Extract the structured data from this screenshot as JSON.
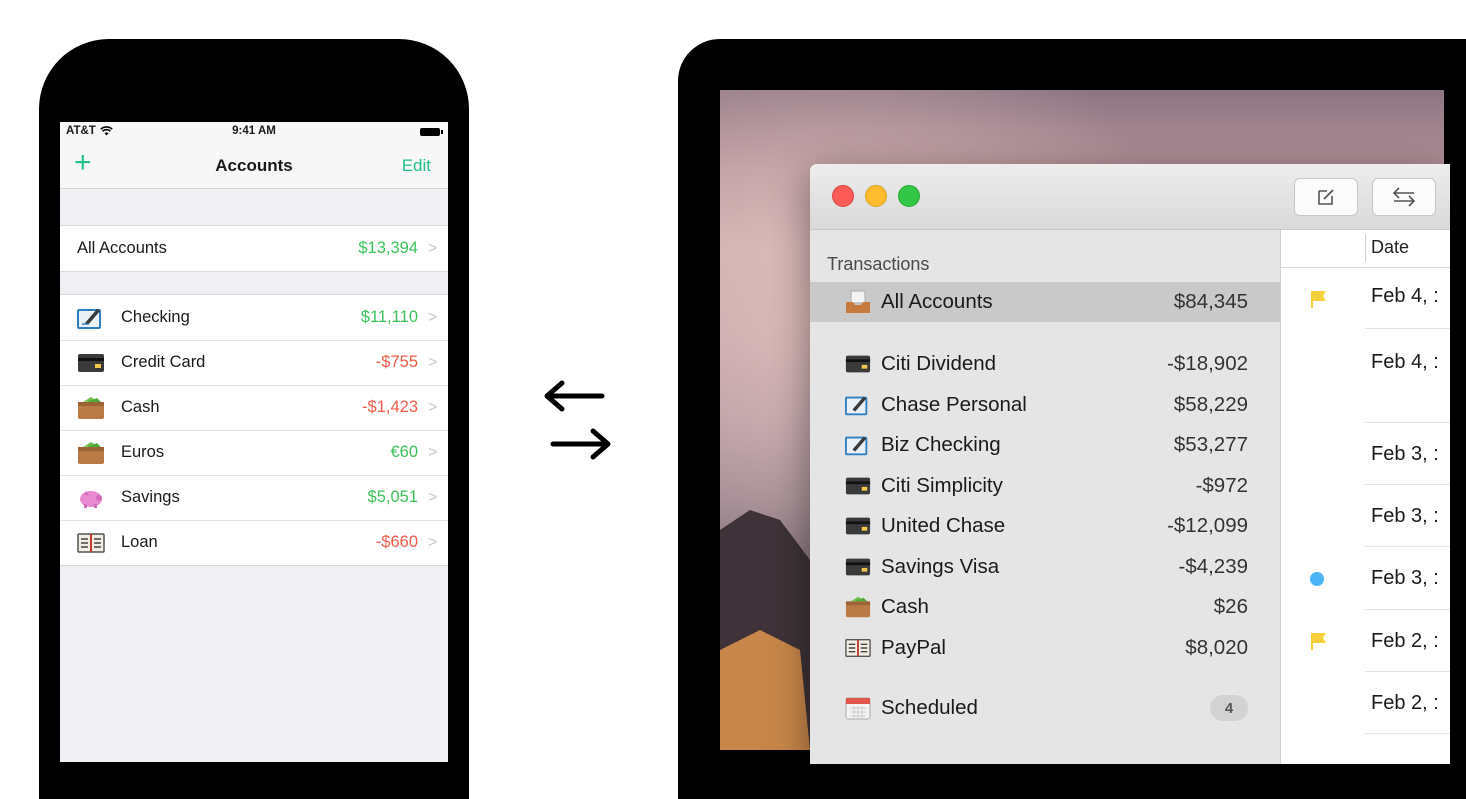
{
  "phone": {
    "status": {
      "carrier": "AT&T",
      "time": "9:41 AM"
    },
    "nav": {
      "title": "Accounts",
      "edit_label": "Edit",
      "add_label": "+"
    },
    "all_accounts": {
      "label": "All Accounts",
      "amount": "$13,394"
    },
    "accounts": [
      {
        "label": "Checking",
        "amount": "$11,110",
        "icon": "checkbook-icon"
      },
      {
        "label": "Credit Card",
        "amount": "-$755",
        "icon": "credit-card-icon"
      },
      {
        "label": "Cash",
        "amount": "-$1,423",
        "icon": "wallet-icon"
      },
      {
        "label": "Euros",
        "amount": "€60",
        "icon": "wallet-icon"
      },
      {
        "label": "Savings",
        "amount": "$5,051",
        "icon": "piggy-bank-icon"
      },
      {
        "label": "Loan",
        "amount": "-$660",
        "icon": "ledger-book-icon"
      }
    ],
    "chevron": ">"
  },
  "mac": {
    "sidebar": {
      "section_title": "Transactions",
      "all_accounts": {
        "label": "All Accounts",
        "amount": "$84,345"
      },
      "accounts": [
        {
          "label": "Citi Dividend",
          "amount": "-$18,902",
          "icon": "credit-card-icon"
        },
        {
          "label": "Chase Personal",
          "amount": "$58,229",
          "icon": "checkbook-icon"
        },
        {
          "label": "Biz Checking",
          "amount": "$53,277",
          "icon": "checkbook-icon"
        },
        {
          "label": "Citi Simplicity",
          "amount": "-$972",
          "icon": "credit-card-icon"
        },
        {
          "label": "United Chase",
          "amount": "-$12,099",
          "icon": "credit-card-icon"
        },
        {
          "label": "Savings Visa",
          "amount": "-$4,239",
          "icon": "credit-card-icon"
        },
        {
          "label": "Cash",
          "amount": "$26",
          "icon": "wallet-icon"
        },
        {
          "label": "PayPal",
          "amount": "$8,020",
          "icon": "ledger-book-icon"
        }
      ],
      "scheduled": {
        "label": "Scheduled",
        "badge": "4"
      }
    },
    "list": {
      "column_header": "Date",
      "rows": [
        {
          "date": "Feb 4, :",
          "marker": "flag"
        },
        {
          "date": "Feb 4, :",
          "marker": ""
        },
        {
          "date": "Feb 3, :",
          "marker": ""
        },
        {
          "date": "Feb 3, :",
          "marker": ""
        },
        {
          "date": "Feb 3, :",
          "marker": "dot"
        },
        {
          "date": "Feb 2, :",
          "marker": "flag"
        },
        {
          "date": "Feb 2, :",
          "marker": ""
        }
      ]
    }
  },
  "colors": {
    "accent": "#1cc28a",
    "positive": "#3cc15a",
    "negative": "#ee5d47",
    "flag": "#f6d13c",
    "dot": "#4ab4f7"
  }
}
